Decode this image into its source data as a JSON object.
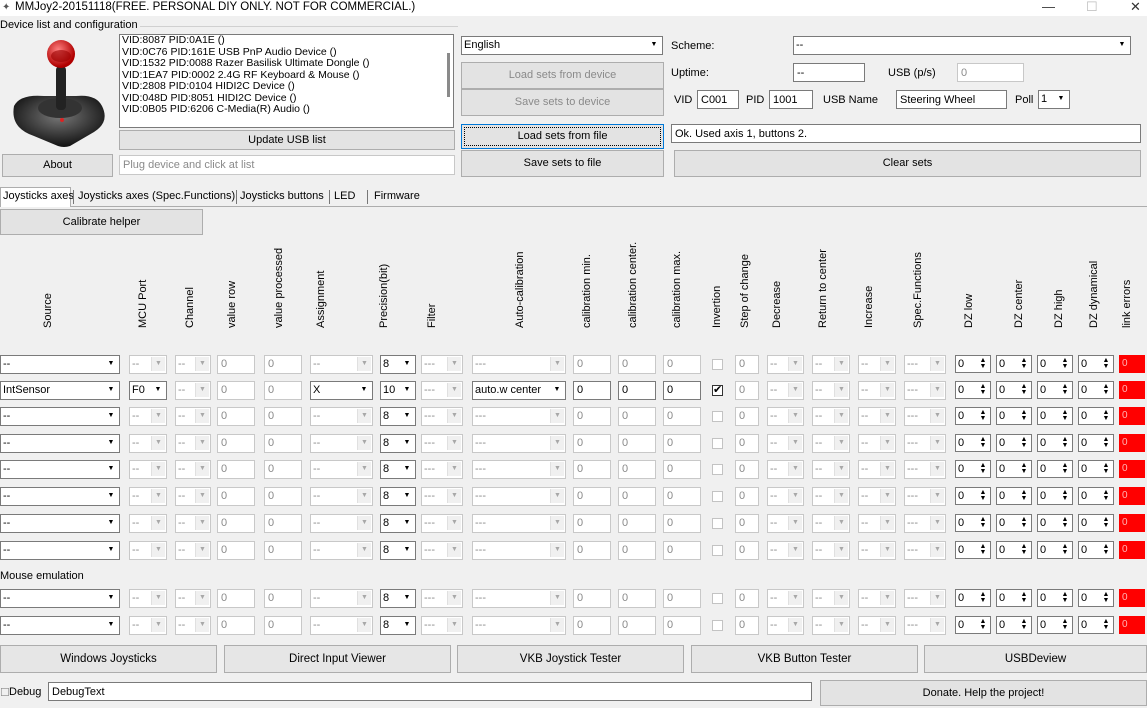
{
  "window": {
    "title": "MMJoy2-20151118(FREE. PERSONAL DIY ONLY. NOT FOR COMMERCIAL.)",
    "min": "—",
    "max": "☐",
    "close": "✕"
  },
  "devices": {
    "group_label": "Device list and configuration",
    "list": [
      "VID:8087 PID:0A1E  ()",
      "VID:0C76 PID:161E USB PnP Audio Device ()",
      "VID:1532 PID:0088 Razer Basilisk Ultimate Dongle ()",
      "VID:1EA7 PID:0002 2.4G RF Keyboard & Mouse ()",
      "VID:2808 PID:0104 HIDI2C Device ()",
      "VID:048D PID:8051 HIDI2C Device ()",
      "VID:0B05 PID:6206 C-Media(R) Audio ()"
    ],
    "update_btn": "Update USB list",
    "about_btn": "About",
    "hint": "Plug device and click at list"
  },
  "actions": {
    "language": "English",
    "load_device": "Load sets from device",
    "save_device": "Save sets to device",
    "load_file": "Load sets from file",
    "save_file": "Save sets to file",
    "clear": "Clear sets"
  },
  "config": {
    "scheme_label": "Scheme:",
    "scheme_value": "--",
    "uptime_label": "Uptime:",
    "uptime_value": "--",
    "usb_label": "USB (p/s)",
    "usb_value": "0",
    "vid_label": "VID",
    "vid_value": "C001",
    "pid_label": "PID",
    "pid_value": "1001",
    "usbname_label": "USB Name",
    "usbname_value": "Steering Wheel",
    "poll_label": "Poll",
    "poll_value": "1",
    "status": "Ok. Used axis  1, buttons 2."
  },
  "tabs": [
    "Joysticks axes",
    "Joysticks axes (Spec.Functions)",
    "Joysticks buttons",
    "LED",
    "Firmware"
  ],
  "calibrate_btn": "Calibrate helper",
  "headers": [
    "Source",
    "MCU Port",
    "Channel",
    "value row",
    "value processed",
    "Assignment",
    "Precision(bit)",
    "Filter",
    "Auto-calibration",
    "calibration min.",
    "calibration center.",
    "calibration max.",
    "Invertion",
    "Step of change",
    "Decrease",
    "Return to center",
    "Increase",
    "Spec.Functions",
    "DZ low",
    "DZ center",
    "DZ high",
    "DZ dynamical",
    "link errors"
  ],
  "rows": [
    {
      "source": "--",
      "port": "--",
      "channel": "--",
      "vrow": "0",
      "vproc": "0",
      "assign": "--",
      "prec": "8",
      "filter": "---",
      "autocal": "---",
      "cmin": "0",
      "ccen": "0",
      "cmax": "0",
      "inv": false,
      "step": "0",
      "dec": "--",
      "ret": "--",
      "inc": "--",
      "spec": "---",
      "dzl": "0",
      "dzc": "0",
      "dzh": "0",
      "dzd": "0",
      "err": "0",
      "enabled": false
    },
    {
      "source": "IntSensor",
      "port": "F0",
      "channel": "--",
      "vrow": "0",
      "vproc": "0",
      "assign": "X",
      "prec": "10",
      "filter": "---",
      "autocal": "auto.w center",
      "cmin": "0",
      "ccen": "0",
      "cmax": "0",
      "inv": true,
      "step": "0",
      "dec": "--",
      "ret": "--",
      "inc": "--",
      "spec": "---",
      "dzl": "0",
      "dzc": "0",
      "dzh": "0",
      "dzd": "0",
      "err": "0",
      "enabled": true
    },
    {
      "source": "--",
      "port": "--",
      "channel": "--",
      "vrow": "0",
      "vproc": "0",
      "assign": "--",
      "prec": "8",
      "filter": "---",
      "autocal": "---",
      "cmin": "0",
      "ccen": "0",
      "cmax": "0",
      "inv": false,
      "step": "0",
      "dec": "--",
      "ret": "--",
      "inc": "--",
      "spec": "---",
      "dzl": "0",
      "dzc": "0",
      "dzh": "0",
      "dzd": "0",
      "err": "0",
      "enabled": false
    },
    {
      "source": "--",
      "port": "--",
      "channel": "--",
      "vrow": "0",
      "vproc": "0",
      "assign": "--",
      "prec": "8",
      "filter": "---",
      "autocal": "---",
      "cmin": "0",
      "ccen": "0",
      "cmax": "0",
      "inv": false,
      "step": "0",
      "dec": "--",
      "ret": "--",
      "inc": "--",
      "spec": "---",
      "dzl": "0",
      "dzc": "0",
      "dzh": "0",
      "dzd": "0",
      "err": "0",
      "enabled": false
    },
    {
      "source": "--",
      "port": "--",
      "channel": "--",
      "vrow": "0",
      "vproc": "0",
      "assign": "--",
      "prec": "8",
      "filter": "---",
      "autocal": "---",
      "cmin": "0",
      "ccen": "0",
      "cmax": "0",
      "inv": false,
      "step": "0",
      "dec": "--",
      "ret": "--",
      "inc": "--",
      "spec": "---",
      "dzl": "0",
      "dzc": "0",
      "dzh": "0",
      "dzd": "0",
      "err": "0",
      "enabled": false
    },
    {
      "source": "--",
      "port": "--",
      "channel": "--",
      "vrow": "0",
      "vproc": "0",
      "assign": "--",
      "prec": "8",
      "filter": "---",
      "autocal": "---",
      "cmin": "0",
      "ccen": "0",
      "cmax": "0",
      "inv": false,
      "step": "0",
      "dec": "--",
      "ret": "--",
      "inc": "--",
      "spec": "---",
      "dzl": "0",
      "dzc": "0",
      "dzh": "0",
      "dzd": "0",
      "err": "0",
      "enabled": false
    },
    {
      "source": "--",
      "port": "--",
      "channel": "--",
      "vrow": "0",
      "vproc": "0",
      "assign": "--",
      "prec": "8",
      "filter": "---",
      "autocal": "---",
      "cmin": "0",
      "ccen": "0",
      "cmax": "0",
      "inv": false,
      "step": "0",
      "dec": "--",
      "ret": "--",
      "inc": "--",
      "spec": "---",
      "dzl": "0",
      "dzc": "0",
      "dzh": "0",
      "dzd": "0",
      "err": "0",
      "enabled": false
    },
    {
      "source": "--",
      "port": "--",
      "channel": "--",
      "vrow": "0",
      "vproc": "0",
      "assign": "--",
      "prec": "8",
      "filter": "---",
      "autocal": "---",
      "cmin": "0",
      "ccen": "0",
      "cmax": "0",
      "inv": false,
      "step": "0",
      "dec": "--",
      "ret": "--",
      "inc": "--",
      "spec": "---",
      "dzl": "0",
      "dzc": "0",
      "dzh": "0",
      "dzd": "0",
      "err": "0",
      "enabled": false
    }
  ],
  "mouse_label": "Mouse emulation",
  "mouse_rows": [
    {
      "source": "--",
      "port": "--",
      "channel": "--",
      "vrow": "0",
      "vproc": "0",
      "assign": "--",
      "prec": "8",
      "filter": "---",
      "autocal": "---",
      "cmin": "0",
      "ccen": "0",
      "cmax": "0",
      "inv": false,
      "step": "0",
      "dec": "--",
      "ret": "--",
      "inc": "--",
      "spec": "---",
      "dzl": "0",
      "dzc": "0",
      "dzh": "0",
      "dzd": "0",
      "err": "0",
      "enabled": false
    },
    {
      "source": "--",
      "port": "--",
      "channel": "--",
      "vrow": "0",
      "vproc": "0",
      "assign": "--",
      "prec": "8",
      "filter": "---",
      "autocal": "---",
      "cmin": "0",
      "ccen": "0",
      "cmax": "0",
      "inv": false,
      "step": "0",
      "dec": "--",
      "ret": "--",
      "inc": "--",
      "spec": "---",
      "dzl": "0",
      "dzc": "0",
      "dzh": "0",
      "dzd": "0",
      "err": "0",
      "enabled": false
    }
  ],
  "bottom_buttons": [
    "Windows Joysticks",
    "Direct Input Viewer",
    "VKB Joystick Tester",
    "VKB Button Tester",
    "USBDeview"
  ],
  "debug": {
    "label": "Debug",
    "value": "DebugText",
    "donate": "Donate. Help the project!"
  },
  "colors": {
    "link_error": "#ff0000",
    "accent": "#0078d7"
  }
}
